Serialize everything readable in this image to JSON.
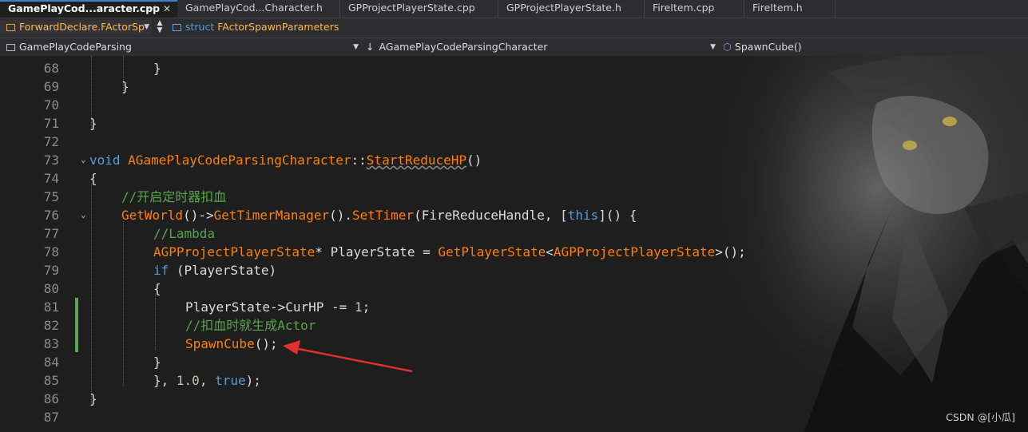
{
  "tabs": [
    {
      "label": "GamePlayCod...aracter.cpp",
      "pin": "⊣",
      "close": "✕"
    },
    {
      "label": "GamePlayCod...Character.h"
    },
    {
      "label": "GPProjectPlayerState.cpp"
    },
    {
      "label": "GPProjectPlayerState.h"
    },
    {
      "label": "FireItem.cpp"
    },
    {
      "label": "FireItem.h"
    }
  ],
  "nav": {
    "scope_combo": "ForwardDeclare.FActorSp",
    "struct_keyword": "struct",
    "struct_name": "FActorSpawnParameters",
    "project_combo": "GamePlayCodeParsing",
    "class_combo": "AGamePlayCodeParsingCharacter",
    "member_combo": "SpawnCube()"
  },
  "lines": [
    {
      "num": "68",
      "indent": 2,
      "tokens": [
        {
          "t": "}",
          "c": "pl"
        }
      ]
    },
    {
      "num": "69",
      "indent": 1,
      "tokens": [
        {
          "t": "}",
          "c": "pl"
        }
      ]
    },
    {
      "num": "70",
      "indent": 0,
      "tokens": []
    },
    {
      "num": "71",
      "indent": 0,
      "tokens": [
        {
          "t": "}",
          "c": "pl"
        }
      ]
    },
    {
      "num": "72",
      "indent": 0,
      "tokens": []
    },
    {
      "num": "73",
      "indent": 0,
      "fold": true,
      "tokens": [
        {
          "t": "void ",
          "c": "kw"
        },
        {
          "t": "AGamePlayCodeParsingCharacter",
          "c": "cls"
        },
        {
          "t": "::",
          "c": "pl"
        },
        {
          "t": "StartReduceHP",
          "c": "fn",
          "ul": true
        },
        {
          "t": "()",
          "c": "pl"
        }
      ]
    },
    {
      "num": "74",
      "indent": 0,
      "tokens": [
        {
          "t": "{",
          "c": "pl"
        }
      ]
    },
    {
      "num": "75",
      "indent": 1,
      "tokens": [
        {
          "t": "//开启定时器扣血",
          "c": "cm"
        }
      ]
    },
    {
      "num": "76",
      "indent": 1,
      "fold": true,
      "tokens": [
        {
          "t": "GetWorld",
          "c": "fn"
        },
        {
          "t": "()->",
          "c": "pl"
        },
        {
          "t": "GetTimerManager",
          "c": "fn"
        },
        {
          "t": "().",
          "c": "pl"
        },
        {
          "t": "SetTimer",
          "c": "fn"
        },
        {
          "t": "(FireReduceHandle, [",
          "c": "pl"
        },
        {
          "t": "this",
          "c": "kw"
        },
        {
          "t": "]() {",
          "c": "pl"
        }
      ]
    },
    {
      "num": "77",
      "indent": 2,
      "tokens": [
        {
          "t": "//Lambda",
          "c": "cm"
        }
      ]
    },
    {
      "num": "78",
      "indent": 2,
      "tokens": [
        {
          "t": "AGPProjectPlayerState",
          "c": "cls"
        },
        {
          "t": "* PlayerState = ",
          "c": "pl"
        },
        {
          "t": "GetPlayerState",
          "c": "fn"
        },
        {
          "t": "<",
          "c": "pl"
        },
        {
          "t": "AGPProjectPlayerState",
          "c": "cls"
        },
        {
          "t": ">();",
          "c": "pl"
        }
      ]
    },
    {
      "num": "79",
      "indent": 2,
      "tokens": [
        {
          "t": "if",
          "c": "kw"
        },
        {
          "t": " (PlayerState)",
          "c": "pl"
        }
      ]
    },
    {
      "num": "80",
      "indent": 2,
      "tokens": [
        {
          "t": "{",
          "c": "pl"
        }
      ]
    },
    {
      "num": "81",
      "indent": 3,
      "changed": true,
      "tokens": [
        {
          "t": "PlayerState->CurHP -= ",
          "c": "pl"
        },
        {
          "t": "1",
          "c": "num"
        },
        {
          "t": ";",
          "c": "pl"
        }
      ]
    },
    {
      "num": "82",
      "indent": 3,
      "changed": true,
      "tokens": [
        {
          "t": "//扣血时就生成Actor",
          "c": "cm"
        }
      ]
    },
    {
      "num": "83",
      "indent": 3,
      "changed": true,
      "tokens": [
        {
          "t": "SpawnCube",
          "c": "fn"
        },
        {
          "t": "();",
          "c": "pl"
        }
      ]
    },
    {
      "num": "84",
      "indent": 2,
      "tokens": [
        {
          "t": "}",
          "c": "pl"
        }
      ]
    },
    {
      "num": "85",
      "indent": 2,
      "tokens": [
        {
          "t": "}, ",
          "c": "pl"
        },
        {
          "t": "1.0",
          "c": "num"
        },
        {
          "t": ", ",
          "c": "pl"
        },
        {
          "t": "true",
          "c": "kw"
        },
        {
          "t": ");",
          "c": "pl"
        }
      ]
    },
    {
      "num": "86",
      "indent": 0,
      "tokens": [
        {
          "t": "}",
          "c": "pl"
        }
      ]
    },
    {
      "num": "87",
      "indent": 0,
      "tokens": []
    }
  ],
  "colors": {
    "keyword": "#569cd6",
    "function": "#ff8000",
    "comment": "#57a64a",
    "arrow": "#e03030",
    "change_bar": "#5aa35a"
  },
  "watermark": "CSDN @[小瓜]"
}
